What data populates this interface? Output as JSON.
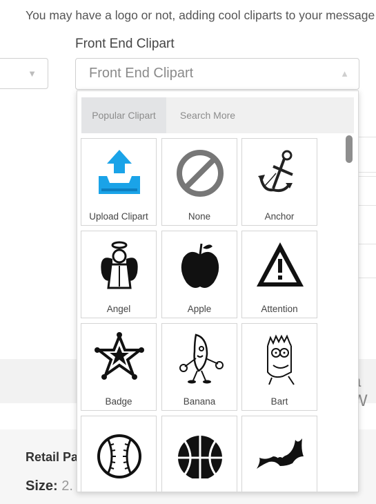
{
  "intro_text": "You may have a logo or not, adding cool cliparts to your message",
  "field": {
    "label": "Front End Clipart",
    "placeholder": "Front End Clipart",
    "arrow_up": "▲",
    "arrow_down": "▼"
  },
  "tabs": [
    {
      "label": "Popular Clipart",
      "active": true
    },
    {
      "label": "Search More",
      "active": false
    }
  ],
  "cliparts": [
    {
      "label": "Upload Clipart",
      "icon": "upload-icon"
    },
    {
      "label": "None",
      "icon": "none-icon"
    },
    {
      "label": "Anchor",
      "icon": "anchor-icon"
    },
    {
      "label": "Angel",
      "icon": "angel-icon"
    },
    {
      "label": "Apple",
      "icon": "apple-icon"
    },
    {
      "label": "Attention",
      "icon": "attention-icon"
    },
    {
      "label": "Badge",
      "icon": "badge-icon"
    },
    {
      "label": "Banana",
      "icon": "banana-icon"
    },
    {
      "label": "Bart",
      "icon": "bart-icon"
    },
    {
      "label": "",
      "icon": "baseball-icon"
    },
    {
      "label": "",
      "icon": "basketball-icon"
    },
    {
      "label": "",
      "icon": "bat-icon"
    }
  ],
  "background": {
    "band_text": "a W",
    "retail_label": "Retail Pa",
    "size_label": "Size:",
    "size_value": "2."
  },
  "colors": {
    "upload_blue": "#1aa3e8",
    "tab_active": "#e3e4e6"
  }
}
